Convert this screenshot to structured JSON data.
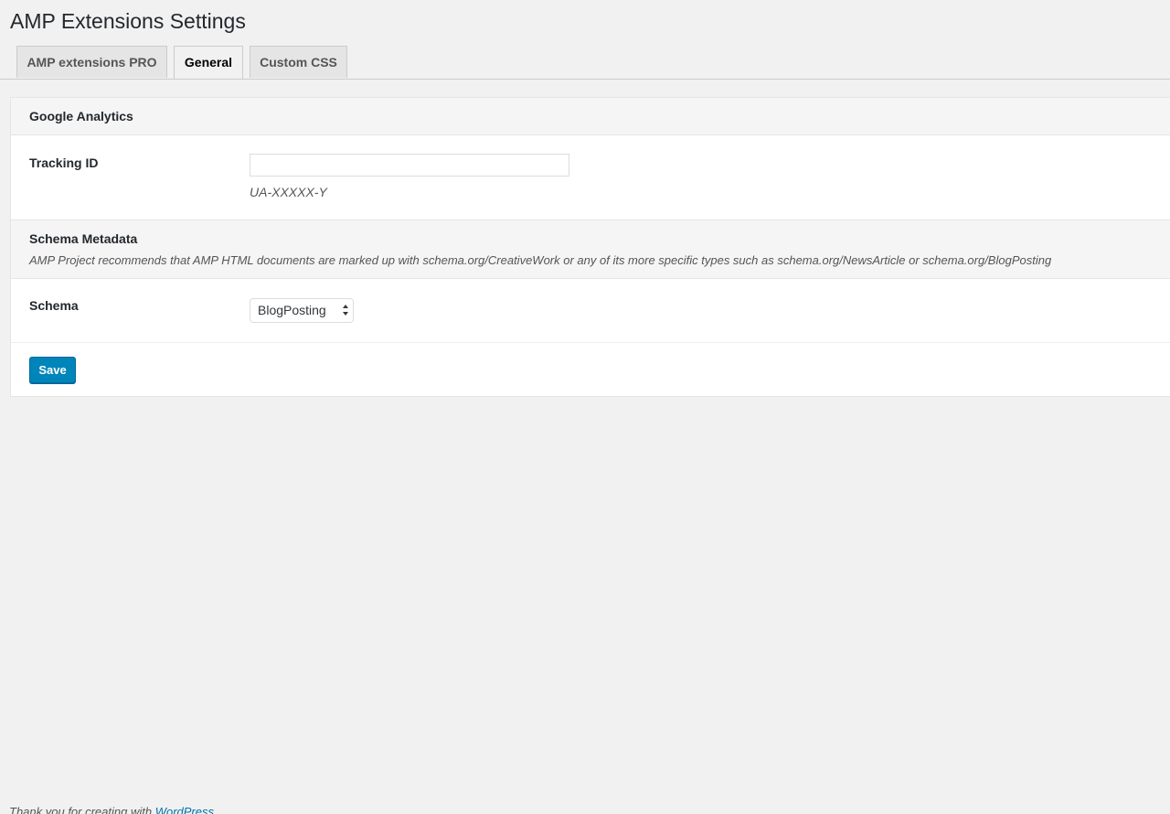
{
  "page": {
    "title": "AMP Extensions Settings"
  },
  "tabs": [
    {
      "label": "AMP extensions PRO",
      "active": false
    },
    {
      "label": "General",
      "active": true
    },
    {
      "label": "Custom CSS",
      "active": false
    }
  ],
  "google_analytics": {
    "heading": "Google Analytics",
    "tracking_label": "Tracking ID",
    "tracking_value": "",
    "tracking_hint": "UA-XXXXX-Y"
  },
  "schema_metadata": {
    "heading": "Schema Metadata",
    "description": "AMP Project recommends that AMP HTML documents are marked up with schema.org/CreativeWork or any of its more specific types such as schema.org/NewsArticle or schema.org/BlogPosting",
    "schema_label": "Schema",
    "schema_selected": "BlogPosting"
  },
  "actions": {
    "save_label": "Save"
  },
  "footer": {
    "text": "Thank you for creating with ",
    "link": "WordPress"
  },
  "colors": {
    "primary_button": "#0085ba",
    "background": "#f1f1f1"
  }
}
